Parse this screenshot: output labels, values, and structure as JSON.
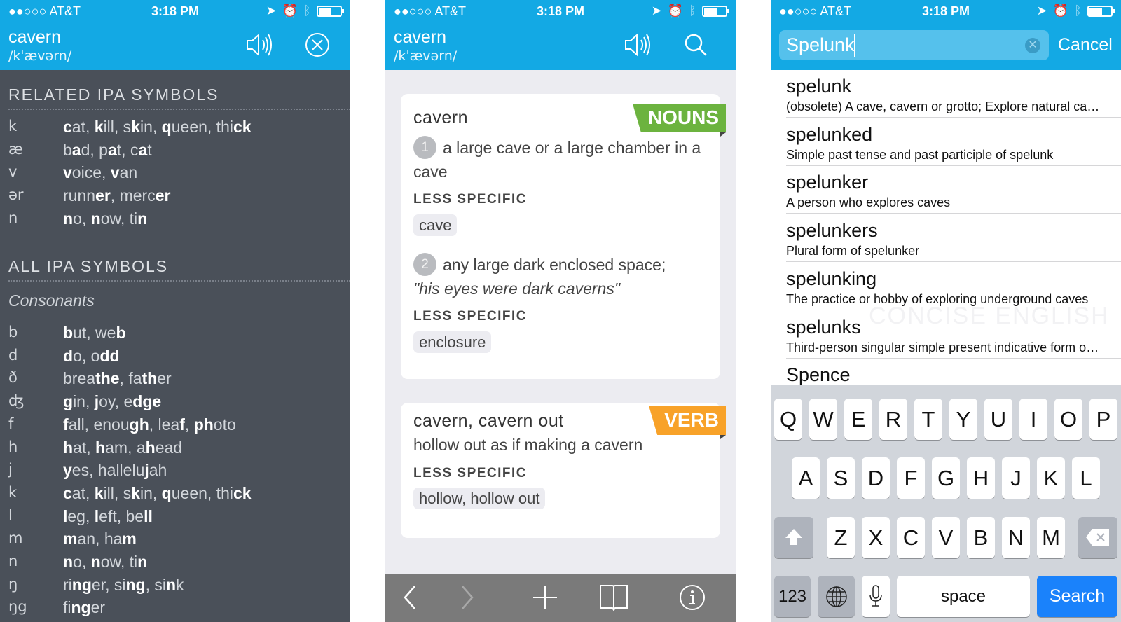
{
  "status": {
    "carrier": "●●○○○ AT&T",
    "time": "3:18 PM"
  },
  "panel1": {
    "word": "cavern",
    "ipa": "/kˈævərn/",
    "related_heading": "RELATED IPA SYMBOLS",
    "related": [
      {
        "sym": "k",
        "ex": [
          "",
          "c",
          "at, ",
          "k",
          "ill, s",
          "k",
          "in, ",
          "q",
          "ueen, thi",
          "ck"
        ]
      },
      {
        "sym": "æ",
        "ex": [
          "b",
          "a",
          "d, p",
          "a",
          "t, c",
          "a",
          "t"
        ]
      },
      {
        "sym": "v",
        "ex": [
          "",
          "v",
          "oice, ",
          "v",
          "an"
        ]
      },
      {
        "sym": "ər",
        "ex": [
          "runn",
          "er",
          ", merc",
          "er"
        ]
      },
      {
        "sym": "n",
        "ex": [
          "",
          "n",
          "o, ",
          "n",
          "ow, ti",
          "n"
        ]
      }
    ],
    "all_heading": "ALL IPA SYMBOLS",
    "subheading": "Consonants",
    "consonants": [
      {
        "sym": "b",
        "ex": [
          "",
          "b",
          "ut, we",
          "b"
        ]
      },
      {
        "sym": "d",
        "ex": [
          "",
          "d",
          "o, o",
          "dd"
        ]
      },
      {
        "sym": "ð",
        "ex": [
          "brea",
          "the",
          ", fa",
          "th",
          "er"
        ]
      },
      {
        "sym": "ʤ",
        "ex": [
          "",
          "g",
          "in, ",
          "j",
          "oy, e",
          "dge"
        ]
      },
      {
        "sym": "f",
        "ex": [
          "",
          "f",
          "all, enou",
          "gh",
          ", lea",
          "f",
          ", ",
          "ph",
          "oto"
        ]
      },
      {
        "sym": "h",
        "ex": [
          "",
          "h",
          "at, ",
          "h",
          "am, a",
          "h",
          "ead"
        ]
      },
      {
        "sym": "j",
        "ex": [
          "",
          "y",
          "es, hallelu",
          "j",
          "ah"
        ]
      },
      {
        "sym": "k",
        "ex": [
          "",
          "c",
          "at, ",
          "k",
          "ill, s",
          "k",
          "in, ",
          "q",
          "ueen, thi",
          "ck"
        ]
      },
      {
        "sym": "l",
        "ex": [
          "",
          "l",
          "eg, ",
          "l",
          "eft, be",
          "ll"
        ]
      },
      {
        "sym": "m",
        "ex": [
          "",
          "m",
          "an, ha",
          "m"
        ]
      },
      {
        "sym": "n",
        "ex": [
          "",
          "n",
          "o, ",
          "n",
          "ow, ti",
          "n"
        ]
      },
      {
        "sym": "ŋ",
        "ex": [
          "ri",
          "ng",
          "er, si",
          "ng",
          ", si",
          "n",
          "k"
        ]
      },
      {
        "sym": "ŋg",
        "ex": [
          "fi",
          "ng",
          "er"
        ]
      }
    ]
  },
  "panel2": {
    "word": "cavern",
    "ipa": "/kˈævərn/",
    "cards": [
      {
        "title": "cavern",
        "pos": "NOUNS",
        "color": "#6cb33f",
        "defs": [
          {
            "num": "1",
            "text": "a large cave or a large chamber in a cave",
            "label": "LESS SPECIFIC",
            "chip": "cave"
          },
          {
            "num": "2",
            "text": "any large dark enclosed space;",
            "example": "\"his eyes were dark caverns\"",
            "label": "LESS SPECIFIC",
            "chip": "enclosure"
          }
        ]
      },
      {
        "title": "cavern, cavern out",
        "pos": "VERB",
        "color": "#f8a229",
        "defs": [
          {
            "text": "hollow out as if making a cavern",
            "label": "LESS SPECIFIC",
            "chip": "hollow, hollow out"
          }
        ]
      }
    ]
  },
  "panel3": {
    "query": "Spelunk",
    "cancel": "Cancel",
    "results": [
      {
        "word": "spelunk",
        "desc": "(obsolete) A cave, cavern or grotto; Explore natural caves"
      },
      {
        "word": "spelunked",
        "desc": "Simple past tense and past participle of spelunk"
      },
      {
        "word": "spelunker",
        "desc": "A person who explores caves"
      },
      {
        "word": "spelunkers",
        "desc": "Plural form of spelunker"
      },
      {
        "word": "spelunking",
        "desc": "The practice or hobby of exploring underground caves"
      },
      {
        "word": "spelunks",
        "desc": "Third-person singular simple present indicative form of spelunk"
      },
      {
        "word": "Spence",
        "desc": ""
      }
    ],
    "watermark": "CONCISE ENGLISH",
    "keyboard": {
      "rows": [
        [
          "Q",
          "W",
          "E",
          "R",
          "T",
          "Y",
          "U",
          "I",
          "O",
          "P"
        ],
        [
          "A",
          "S",
          "D",
          "F",
          "G",
          "H",
          "J",
          "K",
          "L"
        ],
        [
          "Z",
          "X",
          "C",
          "V",
          "B",
          "N",
          "M"
        ]
      ],
      "numbers": "123",
      "space": "space",
      "search": "Search"
    }
  },
  "colors": {
    "accent": "#13a9e4",
    "ipa_bg": "#4a5059",
    "nouns": "#6cb33f",
    "verb": "#f8a229",
    "search_key": "#1a82fb"
  }
}
